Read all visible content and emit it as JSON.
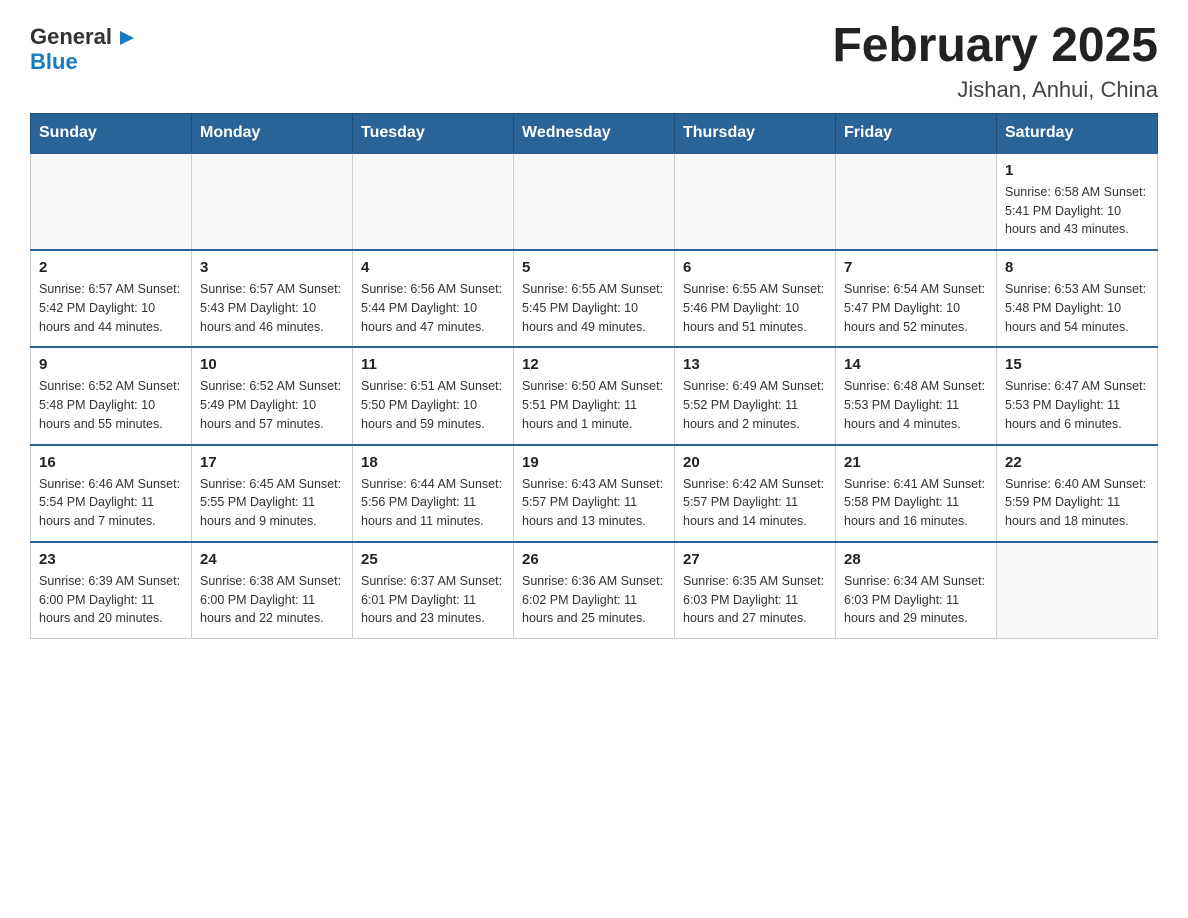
{
  "logo": {
    "general": "General",
    "blue": "Blue",
    "arrow": "▶"
  },
  "title": "February 2025",
  "subtitle": "Jishan, Anhui, China",
  "days_of_week": [
    "Sunday",
    "Monday",
    "Tuesday",
    "Wednesday",
    "Thursday",
    "Friday",
    "Saturday"
  ],
  "weeks": [
    {
      "days": [
        {
          "number": "",
          "info": ""
        },
        {
          "number": "",
          "info": ""
        },
        {
          "number": "",
          "info": ""
        },
        {
          "number": "",
          "info": ""
        },
        {
          "number": "",
          "info": ""
        },
        {
          "number": "",
          "info": ""
        },
        {
          "number": "1",
          "info": "Sunrise: 6:58 AM\nSunset: 5:41 PM\nDaylight: 10 hours\nand 43 minutes."
        }
      ]
    },
    {
      "days": [
        {
          "number": "2",
          "info": "Sunrise: 6:57 AM\nSunset: 5:42 PM\nDaylight: 10 hours\nand 44 minutes."
        },
        {
          "number": "3",
          "info": "Sunrise: 6:57 AM\nSunset: 5:43 PM\nDaylight: 10 hours\nand 46 minutes."
        },
        {
          "number": "4",
          "info": "Sunrise: 6:56 AM\nSunset: 5:44 PM\nDaylight: 10 hours\nand 47 minutes."
        },
        {
          "number": "5",
          "info": "Sunrise: 6:55 AM\nSunset: 5:45 PM\nDaylight: 10 hours\nand 49 minutes."
        },
        {
          "number": "6",
          "info": "Sunrise: 6:55 AM\nSunset: 5:46 PM\nDaylight: 10 hours\nand 51 minutes."
        },
        {
          "number": "7",
          "info": "Sunrise: 6:54 AM\nSunset: 5:47 PM\nDaylight: 10 hours\nand 52 minutes."
        },
        {
          "number": "8",
          "info": "Sunrise: 6:53 AM\nSunset: 5:48 PM\nDaylight: 10 hours\nand 54 minutes."
        }
      ]
    },
    {
      "days": [
        {
          "number": "9",
          "info": "Sunrise: 6:52 AM\nSunset: 5:48 PM\nDaylight: 10 hours\nand 55 minutes."
        },
        {
          "number": "10",
          "info": "Sunrise: 6:52 AM\nSunset: 5:49 PM\nDaylight: 10 hours\nand 57 minutes."
        },
        {
          "number": "11",
          "info": "Sunrise: 6:51 AM\nSunset: 5:50 PM\nDaylight: 10 hours\nand 59 minutes."
        },
        {
          "number": "12",
          "info": "Sunrise: 6:50 AM\nSunset: 5:51 PM\nDaylight: 11 hours\nand 1 minute."
        },
        {
          "number": "13",
          "info": "Sunrise: 6:49 AM\nSunset: 5:52 PM\nDaylight: 11 hours\nand 2 minutes."
        },
        {
          "number": "14",
          "info": "Sunrise: 6:48 AM\nSunset: 5:53 PM\nDaylight: 11 hours\nand 4 minutes."
        },
        {
          "number": "15",
          "info": "Sunrise: 6:47 AM\nSunset: 5:53 PM\nDaylight: 11 hours\nand 6 minutes."
        }
      ]
    },
    {
      "days": [
        {
          "number": "16",
          "info": "Sunrise: 6:46 AM\nSunset: 5:54 PM\nDaylight: 11 hours\nand 7 minutes."
        },
        {
          "number": "17",
          "info": "Sunrise: 6:45 AM\nSunset: 5:55 PM\nDaylight: 11 hours\nand 9 minutes."
        },
        {
          "number": "18",
          "info": "Sunrise: 6:44 AM\nSunset: 5:56 PM\nDaylight: 11 hours\nand 11 minutes."
        },
        {
          "number": "19",
          "info": "Sunrise: 6:43 AM\nSunset: 5:57 PM\nDaylight: 11 hours\nand 13 minutes."
        },
        {
          "number": "20",
          "info": "Sunrise: 6:42 AM\nSunset: 5:57 PM\nDaylight: 11 hours\nand 14 minutes."
        },
        {
          "number": "21",
          "info": "Sunrise: 6:41 AM\nSunset: 5:58 PM\nDaylight: 11 hours\nand 16 minutes."
        },
        {
          "number": "22",
          "info": "Sunrise: 6:40 AM\nSunset: 5:59 PM\nDaylight: 11 hours\nand 18 minutes."
        }
      ]
    },
    {
      "days": [
        {
          "number": "23",
          "info": "Sunrise: 6:39 AM\nSunset: 6:00 PM\nDaylight: 11 hours\nand 20 minutes."
        },
        {
          "number": "24",
          "info": "Sunrise: 6:38 AM\nSunset: 6:00 PM\nDaylight: 11 hours\nand 22 minutes."
        },
        {
          "number": "25",
          "info": "Sunrise: 6:37 AM\nSunset: 6:01 PM\nDaylight: 11 hours\nand 23 minutes."
        },
        {
          "number": "26",
          "info": "Sunrise: 6:36 AM\nSunset: 6:02 PM\nDaylight: 11 hours\nand 25 minutes."
        },
        {
          "number": "27",
          "info": "Sunrise: 6:35 AM\nSunset: 6:03 PM\nDaylight: 11 hours\nand 27 minutes."
        },
        {
          "number": "28",
          "info": "Sunrise: 6:34 AM\nSunset: 6:03 PM\nDaylight: 11 hours\nand 29 minutes."
        },
        {
          "number": "",
          "info": ""
        }
      ]
    }
  ]
}
